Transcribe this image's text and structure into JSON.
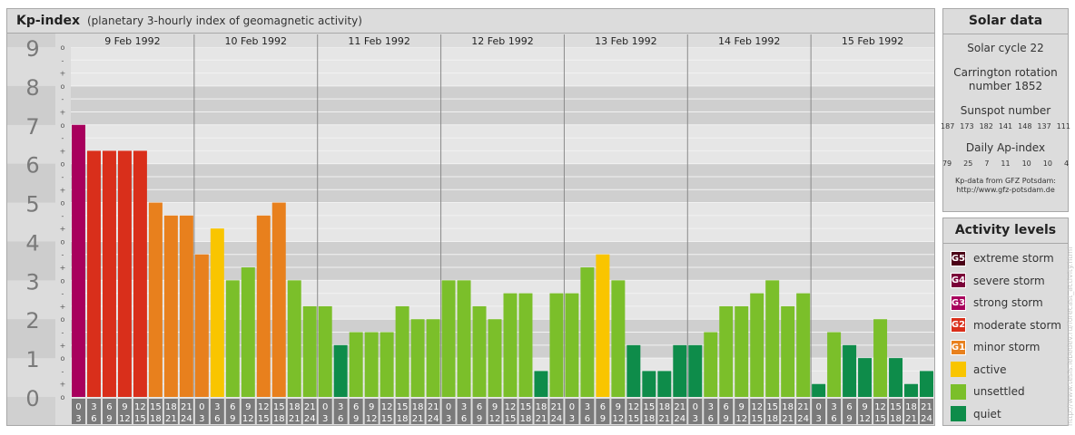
{
  "header": {
    "title": "Kp-index",
    "subtitle": "(planetary 3-hourly index of geomagnetic activity)"
  },
  "chart_data": {
    "type": "bar",
    "y_ticks": [
      "0",
      "1",
      "2",
      "3",
      "4",
      "5",
      "6",
      "7",
      "8",
      "9"
    ],
    "sub_ticks": [
      "o",
      "+",
      "-",
      "o",
      "+",
      "-",
      "o",
      "+",
      "-",
      "o",
      "+",
      "-",
      "o",
      "+",
      "-",
      "o",
      "+",
      "-",
      "o",
      "+",
      "-",
      "o",
      "+",
      "-",
      "o",
      "+",
      "-",
      "o"
    ],
    "ylim": [
      0,
      9
    ],
    "days": [
      "9 Feb 1992",
      "10 Feb 1992",
      "11 Feb 1992",
      "12 Feb 1992",
      "13 Feb 1992",
      "14 Feb 1992",
      "15 Feb 1992"
    ],
    "hour_start": [
      "0",
      "3",
      "6",
      "9",
      "12",
      "15",
      "18",
      "21"
    ],
    "hour_end": [
      "3",
      "6",
      "9",
      "12",
      "15",
      "18",
      "21",
      "24"
    ],
    "values": [
      7.0,
      6.333,
      6.333,
      6.333,
      6.333,
      5.0,
      4.667,
      4.667,
      3.667,
      4.333,
      3.0,
      3.333,
      4.667,
      5.0,
      3.0,
      2.333,
      2.333,
      1.333,
      1.667,
      1.667,
      1.667,
      2.333,
      2.0,
      2.0,
      3.0,
      3.0,
      2.333,
      2.0,
      2.667,
      2.667,
      0.667,
      2.667,
      2.667,
      3.333,
      3.667,
      3.0,
      1.333,
      0.667,
      0.667,
      1.333,
      1.333,
      1.667,
      2.333,
      2.333,
      2.667,
      3.0,
      2.333,
      2.667,
      0.333,
      1.667,
      1.333,
      1.0,
      2.0,
      1.0,
      0.333,
      0.667
    ],
    "colors": [
      "#a8005d",
      "#d92f1b",
      "#d92f1b",
      "#d92f1b",
      "#d92f1b",
      "#e8801d",
      "#e8801d",
      "#e8801d",
      "#e8801d",
      "#f9c500",
      "#7bbf2a",
      "#7bbf2a",
      "#e8801d",
      "#e8801d",
      "#7bbf2a",
      "#7bbf2a",
      "#7bbf2a",
      "#0e8c4a",
      "#7bbf2a",
      "#7bbf2a",
      "#7bbf2a",
      "#7bbf2a",
      "#7bbf2a",
      "#7bbf2a",
      "#7bbf2a",
      "#7bbf2a",
      "#7bbf2a",
      "#7bbf2a",
      "#7bbf2a",
      "#7bbf2a",
      "#0e8c4a",
      "#7bbf2a",
      "#7bbf2a",
      "#7bbf2a",
      "#f9c500",
      "#7bbf2a",
      "#0e8c4a",
      "#0e8c4a",
      "#0e8c4a",
      "#0e8c4a",
      "#0e8c4a",
      "#7bbf2a",
      "#7bbf2a",
      "#7bbf2a",
      "#7bbf2a",
      "#7bbf2a",
      "#7bbf2a",
      "#7bbf2a",
      "#0e8c4a",
      "#7bbf2a",
      "#0e8c4a",
      "#0e8c4a",
      "#7bbf2a",
      "#0e8c4a",
      "#0e8c4a",
      "#0e8c4a"
    ],
    "grid": true
  },
  "solar": {
    "title": "Solar data",
    "cycle": "Solar cycle 22",
    "carrington_1": "Carrington rotation",
    "carrington_2": "number 1852",
    "sunspot_label": "Sunspot number",
    "sunspots": [
      "187",
      "173",
      "182",
      "141",
      "148",
      "137",
      "111"
    ],
    "ap_label": "Daily Ap-index",
    "ap": [
      "79",
      "25",
      "7",
      "11",
      "10",
      "10",
      "4"
    ],
    "source_1": "Kp-data from GFZ Potsdam:",
    "source_2": "http://www.gfz-potsdam.de"
  },
  "activity": {
    "title": "Activity levels",
    "levels": [
      {
        "code": "G5",
        "label": "extreme storm",
        "color": "#4a0016"
      },
      {
        "code": "G4",
        "label": "severe storm",
        "color": "#7a0038"
      },
      {
        "code": "G3",
        "label": "strong storm",
        "color": "#a8005d"
      },
      {
        "code": "G2",
        "label": "moderate storm",
        "color": "#d92f1b"
      },
      {
        "code": "G1",
        "label": "minor storm",
        "color": "#e8801d"
      },
      {
        "code": "",
        "label": "active",
        "color": "#f9c500"
      },
      {
        "code": "",
        "label": "unsettled",
        "color": "#7bbf2a"
      },
      {
        "code": "",
        "label": "quiet",
        "color": "#0e8c4a"
      }
    ]
  },
  "watermark": "http://www.tesis.lebedev.ru/forecast_activity.html"
}
